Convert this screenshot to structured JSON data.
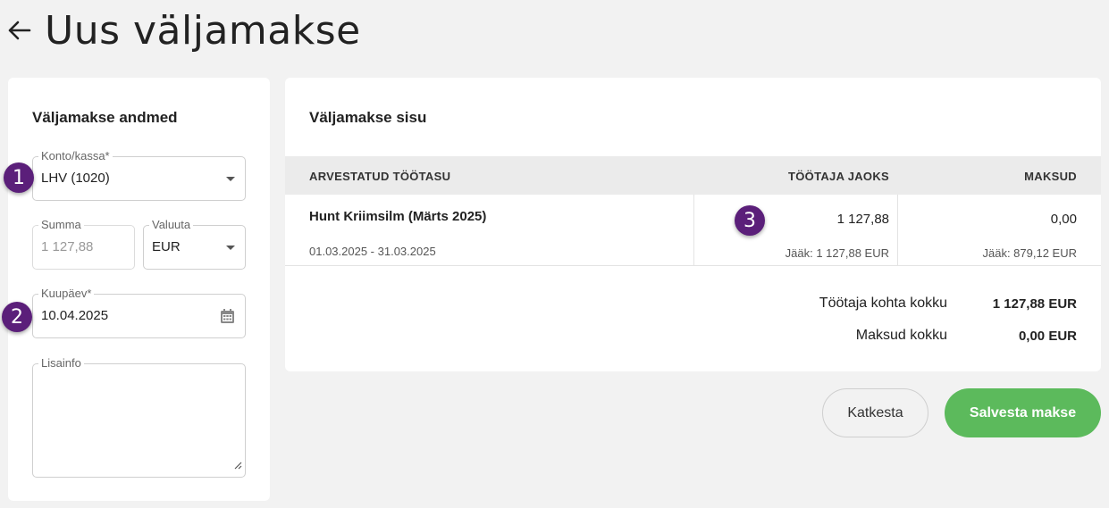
{
  "header": {
    "title": "Uus väljamakse"
  },
  "left_card": {
    "title": "Väljamakse andmed",
    "konto": {
      "label": "Konto/kassa*",
      "value": "LHV (1020)"
    },
    "summa": {
      "label": "Summa",
      "value": "1 127,88"
    },
    "valuuta": {
      "label": "Valuuta",
      "value": "EUR"
    },
    "kuupaev": {
      "label": "Kuupäev*",
      "value": "10.04.2025"
    },
    "lisainfo": {
      "label": "Lisainfo",
      "value": ""
    }
  },
  "right_card": {
    "title": "Väljamakse sisu",
    "columns": [
      "ARVESTATUD TÖÖTASU",
      "TÖÖTAJA JAOKS",
      "MAKSUD"
    ],
    "rows": [
      {
        "name": "Hunt Kriimsilm (Märts 2025)",
        "period": "01.03.2025 - 31.03.2025",
        "tootaja_jaoks": "1 127,88",
        "tootaja_jaak": "Jääk: 1 127,88 EUR",
        "maksud": "0,00",
        "maksud_jaak": "Jääk: 879,12 EUR"
      }
    ],
    "totals": [
      {
        "label": "Töötaja kohta kokku",
        "value": "1 127,88 EUR"
      },
      {
        "label": "Maksud kokku",
        "value": "0,00 EUR"
      }
    ]
  },
  "badges": [
    "1",
    "2",
    "3"
  ],
  "buttons": {
    "cancel": "Katkesta",
    "save": "Salvesta makse"
  },
  "colors": {
    "badge": "#5b1f7a",
    "save_button": "#5cba5c"
  },
  "icons": [
    "back-arrow-icon",
    "chevron-down-icon",
    "calendar-icon",
    "resize-handle-icon"
  ]
}
